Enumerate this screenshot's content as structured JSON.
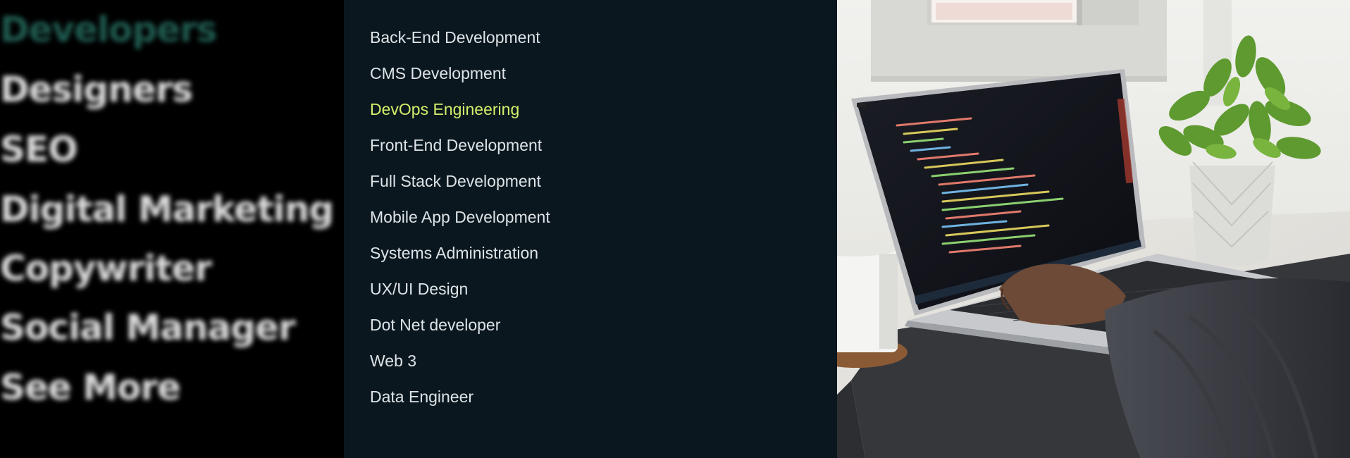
{
  "categories": {
    "items": [
      {
        "label": "Developers",
        "active": true
      },
      {
        "label": "Designers",
        "active": false
      },
      {
        "label": "SEO",
        "active": false
      },
      {
        "label": "Digital Marketing",
        "active": false
      },
      {
        "label": "Copywriter",
        "active": false
      },
      {
        "label": "Social Manager",
        "active": false
      },
      {
        "label": "See More",
        "active": false
      }
    ]
  },
  "roles": {
    "items": [
      {
        "label": "Back-End Development"
      },
      {
        "label": "CMS Development"
      },
      {
        "label": "DevOps Engineering",
        "active": true
      },
      {
        "label": "Front-End Development"
      },
      {
        "label": "Full Stack Development"
      },
      {
        "label": "Mobile App Development"
      },
      {
        "label": "Systems Administration"
      },
      {
        "label": "UX/UI Design"
      },
      {
        "label": "Dot Net developer"
      },
      {
        "label": "Web 3"
      },
      {
        "label": "Data Engineer"
      }
    ]
  },
  "colors": {
    "active_category": "#1f5a4f",
    "active_role": "#d4ef6b",
    "panel_bg": "#0a171e"
  },
  "photo": {
    "subject": "laptop-with-code-editor-photo"
  }
}
